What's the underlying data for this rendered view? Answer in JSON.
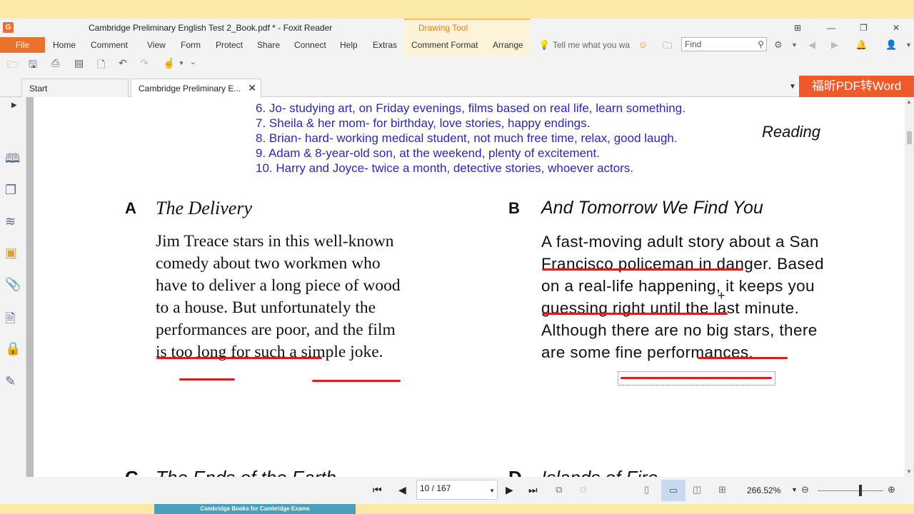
{
  "window": {
    "title": "Cambridge Preliminary English Test 2_Book.pdf * - Foxit Reader",
    "context_tab": "Drawing Tool"
  },
  "menu": {
    "file": "File",
    "items": [
      "Home",
      "Comment",
      "View",
      "Form",
      "Protect",
      "Share",
      "Connect",
      "Help",
      "Extras",
      "Comment Format",
      "Arrange"
    ],
    "tell_me": "Tell me what you wa",
    "find_placeholder": "Find"
  },
  "tabs": [
    {
      "label": "Start"
    },
    {
      "label": "Cambridge Preliminary E..."
    }
  ],
  "promo": {
    "label": "福昕PDF转Word"
  },
  "doc": {
    "lines": [
      "6. Jo- studying art, on Friday evenings, films based on real life, learn something.",
      "7. Sheila & her mom- for birthday, love stories, happy endings.",
      "8. Brian- hard- working medical student, not much free time, relax, good laugh.",
      "9. Adam & 8-year-old son, at the weekend, plenty of excitement.",
      "10. Harry and Joyce- twice a month, detective stories, whoever actors."
    ],
    "reading": "Reading",
    "section_a": {
      "letter": "A",
      "title": "The Delivery",
      "body": [
        "Jim Treace stars in this well-known",
        "comedy about two workmen who",
        "have to deliver a long piece of wood",
        "to a house. But unfortunately the",
        "performances are poor, and the film",
        "is too long for such a simple joke."
      ]
    },
    "section_b": {
      "letter": "B",
      "title": "And Tomorrow We Find You",
      "body": [
        "A fast-moving adult story about a San",
        "Francisco policeman in danger. Based",
        "on a real-life happening, it keeps you",
        "guessing right until the last minute.",
        "Although there are no big stars, there",
        "are some fine performances."
      ]
    },
    "section_c": {
      "letter": "C",
      "title": "The Ends of the Earth"
    },
    "section_d": {
      "letter": "D",
      "title": "Islands of Fire"
    }
  },
  "status": {
    "page": "10 / 167",
    "zoom": "266.52%"
  },
  "bottom_ad": "Cambridge Books for Cambridge Exams"
}
